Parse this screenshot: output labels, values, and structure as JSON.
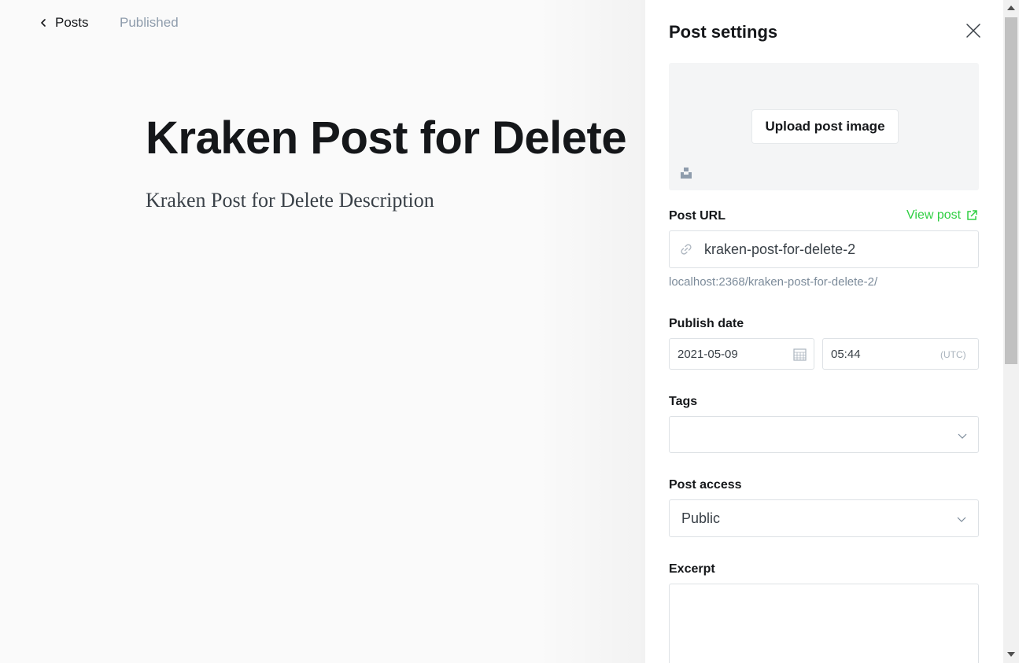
{
  "topbar": {
    "back_label": "Posts",
    "status": "Published"
  },
  "post": {
    "title": "Kraken Post for Delete",
    "excerpt": "Kraken Post for Delete Description"
  },
  "settings": {
    "title": "Post settings",
    "upload_label": "Upload post image",
    "post_url_label": "Post URL",
    "view_post_label": "View post",
    "slug": "kraken-post-for-delete-2",
    "url_hint": "localhost:2368/kraken-post-for-delete-2/",
    "publish_date_label": "Publish date",
    "date": "2021-05-09",
    "time": "05:44",
    "timezone": "(UTC)",
    "tags_label": "Tags",
    "post_access_label": "Post access",
    "post_access_value": "Public",
    "excerpt_label": "Excerpt",
    "excerpt_value": ""
  },
  "colors": {
    "accent_green": "#30cf43",
    "text_dark": "#15171a",
    "muted": "#8e9cac"
  }
}
